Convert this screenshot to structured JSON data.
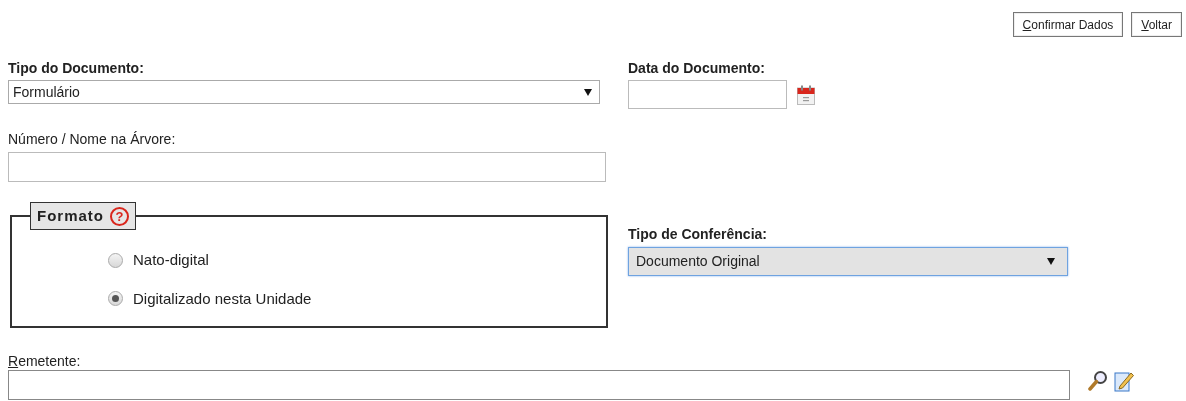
{
  "buttons": [
    {
      "label": "Confirmar Dados",
      "underline_first": true
    },
    {
      "label": "Voltar",
      "underline_first": true
    }
  ],
  "tipo_documento": {
    "label": "Tipo do Documento:",
    "value": "Formulário"
  },
  "data_documento": {
    "label": "Data do Documento:"
  },
  "numero": {
    "label": "Número / Nome na Árvore:"
  },
  "formato": {
    "legend": "Formato",
    "help": "?",
    "options": [
      {
        "label": "Nato-digital",
        "selected": false
      },
      {
        "label": "Digitalizado nesta Unidade",
        "selected": true
      }
    ]
  },
  "tipo_conferencia": {
    "label": "Tipo de Conferência:",
    "value": "Documento Original",
    "focused": true
  },
  "remetente": {
    "label": "Remetente:",
    "underline_first": true
  }
}
